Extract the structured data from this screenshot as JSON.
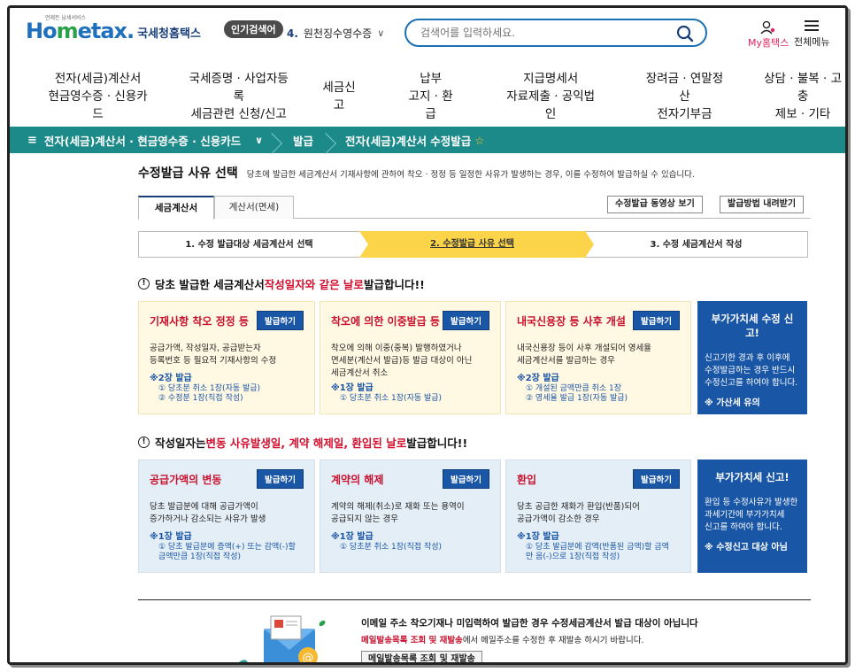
{
  "header": {
    "logo_tiny": "언제든 납세서비스",
    "logo_home": "Ho",
    "logo_e": "m",
    "logo_rest": "etax.",
    "logo_kr": "국세청홈택스",
    "popular_badge": "인기검색어",
    "popular_num": "4.",
    "popular_term": "원천징수영수증",
    "search_placeholder": "검색어를 입력하세요.",
    "myhome": "My홈택스",
    "allmenu": "전체메뉴"
  },
  "gnb": [
    {
      "l1": "전자(세금)계산서",
      "l2": "현금영수증 · 신용카드"
    },
    {
      "l1": "국세증명 · 사업자등록",
      "l2": "세금관련 신청/신고"
    },
    {
      "l1": "세금신고",
      "l2": ""
    },
    {
      "l1": "납부",
      "l2": "고지 · 환급"
    },
    {
      "l1": "지급명세서",
      "l2": "자료제출 · 공익법인"
    },
    {
      "l1": "장려금 · 연말정산",
      "l2": "전자기부금"
    },
    {
      "l1": "상담 · 불복 · 고충",
      "l2": "제보 · 기타"
    }
  ],
  "breadcrumb": {
    "first": "전자(세금)계산서 · 현금영수증 · 신용카드",
    "second": "발급",
    "third": "전자(세금)계산서 수정발급"
  },
  "main": {
    "title": "수정발급 사유 선택",
    "desc": "당초에 발급한 세금계산서 기재사항에 관하여 착오 · 정정 등 일정한 사유가 발생하는 경우, 이를 수정하여 발급하실 수 있습니다.",
    "tabs": [
      "세금계산서",
      "계산서(면세)"
    ],
    "btn_video": "수정발급 동영상 보기",
    "btn_download": "발급방법 내려받기",
    "steps": [
      "1. 수정 발급대상 세금계산서 선택",
      "2. 수정발급 사유 선택",
      "3. 수정 세금계산서 작성"
    ],
    "section1": {
      "pre": "당초 발급한 세금계산서 ",
      "red": "작성일자와 같은 날로",
      "post": " 발급합니다!!"
    },
    "section2": {
      "pre": "작성일자는 ",
      "red": "변동 사유발생일, 계약 해제일, 환입된 날로",
      "post": " 발급합니다!!"
    },
    "issue_label": "발급하기",
    "cards1": [
      {
        "title": "기재사항 착오 정정 등",
        "body": [
          "공급가액, 작성일자, 공급받는자",
          "등록번호 등 필요적 기재사항의 수정"
        ],
        "note": "※2장 발급",
        "subs": [
          "① 당초분 취소 1장(자동 발급)",
          "② 수정분 1장(직접 작성)"
        ]
      },
      {
        "title": "착오에 의한 이중발급 등",
        "body": [
          "착오에 의해 이중(중복) 발행하였거나",
          "면세분(계산서 발급)등 발급 대상이 아닌",
          "세금계산서 취소"
        ],
        "note": "※1장 발급",
        "subs": [
          "① 당초분 취소 1장(자동 발급)"
        ]
      },
      {
        "title": "내국신용장 등 사후 개설",
        "body": [
          "내국신용장 등이 사후 개설되어 영세율",
          "세금계산서를 발급하는 경우"
        ],
        "note": "※2장 발급",
        "subs": [
          "① 개설된 금액만큼 취소 1장",
          "② 영세율 발급 1장(자동 발급)"
        ]
      }
    ],
    "navy1": {
      "title": "부가가치세 수정 신고!",
      "body": [
        "신고기한 경과 후 이후에",
        "수정발급하는 경우 반드시",
        "수정신고를 하여야 합니다."
      ],
      "note": "※ 가산세 유의"
    },
    "cards2": [
      {
        "title": "공급가액의 변동",
        "body": [
          "당초 발급분에 대해 공급가액이",
          "증가하거나 감소되는 사유가 발생"
        ],
        "note": "※1장 발급",
        "subs": [
          "① 당초 발급분에 증액(+) 또는 감액(-)할",
          "금액만큼 1장(직접 작성)"
        ]
      },
      {
        "title": "계약의 해제",
        "body": [
          "계약의 해제(취소)로 재화 또는 용역이",
          "공급되지 않는 경우"
        ],
        "note": "※1장 발급",
        "subs": [
          "① 당초분 취소 1장(직접 작성)"
        ]
      },
      {
        "title": "환입",
        "body": [
          "당초 공급한 재화가 환입(반품)되어",
          "공급가액이 감소한 경우"
        ],
        "note": "※1장 발급",
        "subs": [
          "① 당초 발급분에 감액(반품된 금액)할 금액",
          "만 음(-)으로 1장(직접 작성)"
        ]
      }
    ],
    "navy2": {
      "title": "부가가치세 신고!",
      "body": [
        "환입 등 수정사유가 발생한",
        "과세기간에 부가가치세",
        "신고를 하여야 합니다."
      ],
      "note": "※ 수정신고 대상 아님"
    },
    "bottom": {
      "msg1": "이메일 주소 착오기재나 미입력하여 발급한 경우 수정세금계산서 발급 대상이 아닙니다",
      "msg2_link": "메일발송목록 조회 및 재발송",
      "msg2_rest": "에서 메일주소를 수정한 후 재발송 하시기 바랍니다.",
      "btn": "메일발송목록 조회 및 재발송"
    }
  },
  "colors": {
    "accent": "#1a56a6",
    "teal": "#1d8a8a",
    "step_active": "#fbd44a",
    "red": "#d0102e"
  }
}
